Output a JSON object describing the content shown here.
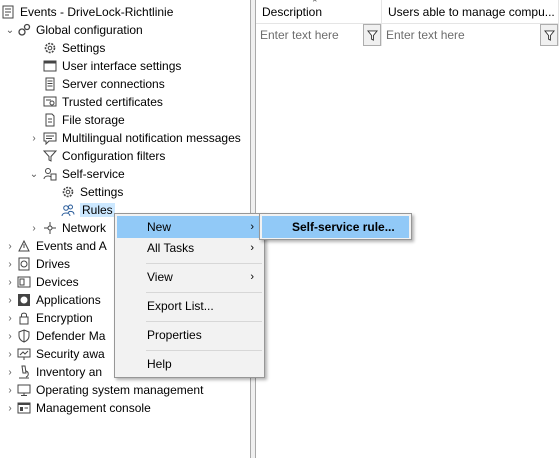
{
  "tree": {
    "root": "Events - DriveLock-Richtlinie",
    "global_config": "Global configuration",
    "settings": "Settings",
    "ui_settings": "User interface settings",
    "server_connections": "Server connections",
    "trusted_certificates": "Trusted certificates",
    "file_storage": "File storage",
    "multilingual": "Multilingual notification messages",
    "config_filters": "Configuration filters",
    "self_service": "Self-service",
    "ss_settings": "Settings",
    "rules": "Rules",
    "network": "Network",
    "events_and": "Events and A",
    "drives": "Drives",
    "devices": "Devices",
    "applications": "Applications",
    "encryption": "Encryption",
    "defender": "Defender Ma",
    "security_awareness": "Security awa",
    "inventory": "Inventory an",
    "os_management": "Operating system management",
    "management_console": "Management console"
  },
  "list": {
    "col_description": "Description",
    "col_users": "Users able to manage compu...",
    "filter_placeholder_1": "Enter text here",
    "filter_placeholder_2": "Enter text here"
  },
  "context_menu": {
    "new": "New",
    "all_tasks": "All Tasks",
    "view": "View",
    "export_list": "Export List...",
    "properties": "Properties",
    "help": "Help"
  },
  "submenu": {
    "self_service_rule": "Self-service rule..."
  },
  "colors": {
    "highlight": "#91c9f7",
    "selection": "#cce8ff",
    "menu_bg": "#f2f2f2"
  }
}
